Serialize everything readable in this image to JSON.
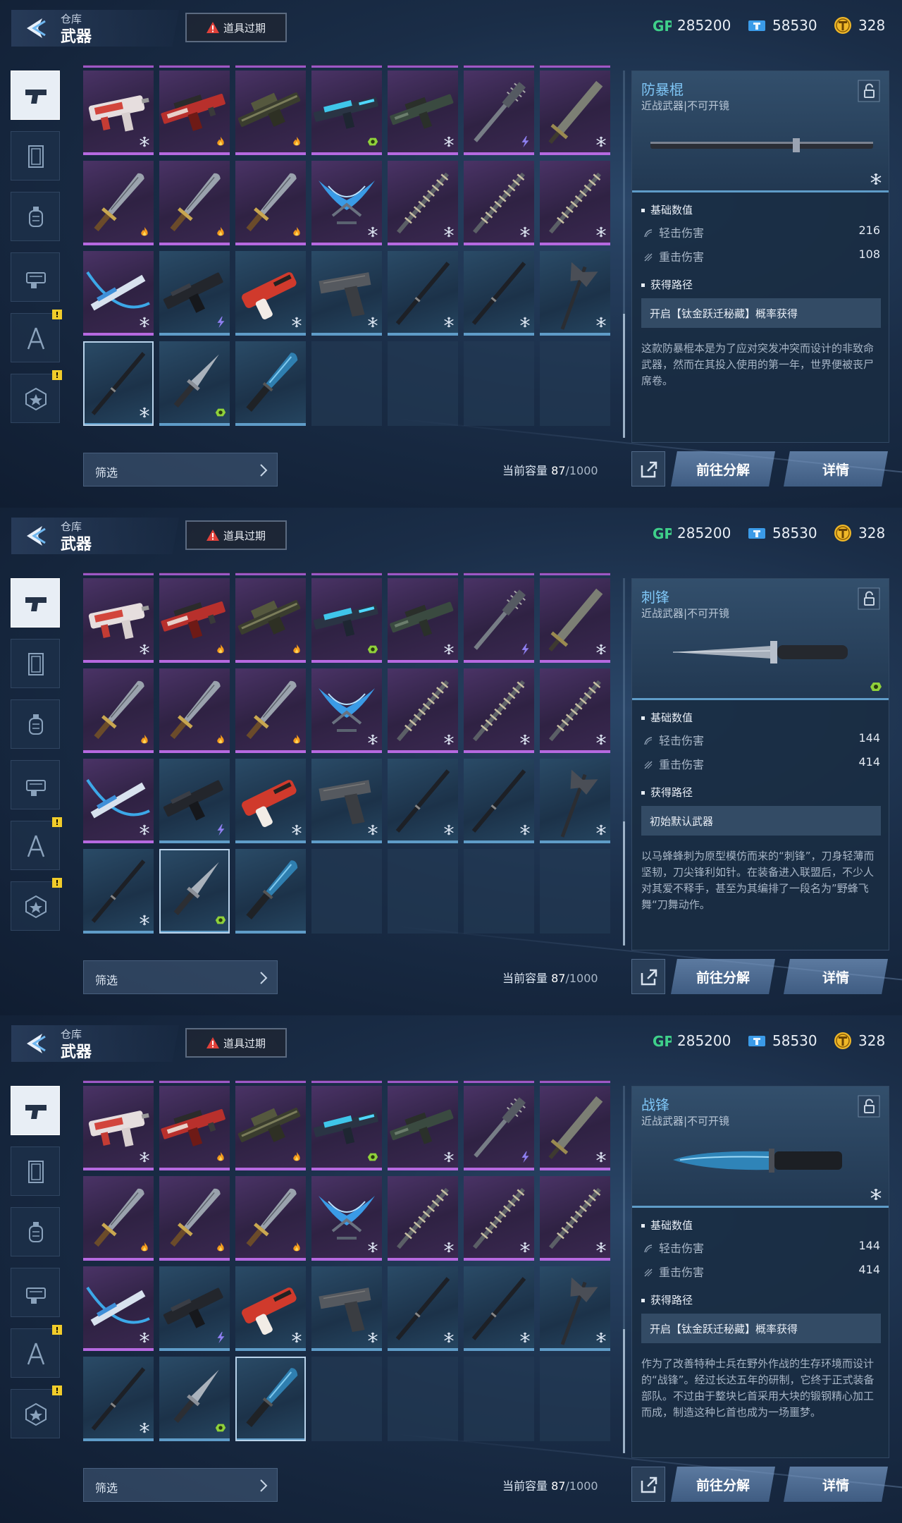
{
  "topbar": {
    "breadcrumb": "仓库",
    "title": "武器",
    "expired_label": "道具过期",
    "gp": {
      "label": "GP",
      "value": "285200"
    },
    "ticket": {
      "value": "58530"
    },
    "coin": {
      "value": "328"
    }
  },
  "sidebar": {
    "tabs": [
      {
        "icon": "pistol-icon"
      },
      {
        "icon": "card-icon"
      },
      {
        "icon": "grenade-icon"
      },
      {
        "icon": "gear-equipment-icon"
      },
      {
        "icon": "tools-icon",
        "badge": "!"
      },
      {
        "icon": "star-emblem-icon",
        "badge": "!"
      }
    ]
  },
  "inventory": {
    "filter_label": "筛选",
    "capacity_label": "当前容量",
    "capacity_current": "87",
    "capacity_total": "/1000"
  },
  "actions": {
    "decompose": "前往分解",
    "details": "详情"
  },
  "weapons_grid": [
    {
      "kind": "smg-white",
      "rarity": "purple",
      "quality": "snowflake"
    },
    {
      "kind": "rifle-red",
      "rarity": "purple",
      "quality": "flame"
    },
    {
      "kind": "lmg-camo",
      "rarity": "purple",
      "quality": "flame"
    },
    {
      "kind": "rifle-cyan",
      "rarity": "purple",
      "quality": "green"
    },
    {
      "kind": "rifle-dark",
      "rarity": "purple",
      "quality": "snowflake"
    },
    {
      "kind": "spiked-club",
      "rarity": "purple",
      "quality": "lightning"
    },
    {
      "kind": "greatsword",
      "rarity": "purple",
      "quality": "snowflake"
    },
    {
      "kind": "knife",
      "rarity": "purple",
      "quality": "flame"
    },
    {
      "kind": "knife",
      "rarity": "purple",
      "quality": "flame"
    },
    {
      "kind": "knife",
      "rarity": "purple",
      "quality": "flame"
    },
    {
      "kind": "dual-blades",
      "rarity": "purple",
      "quality": "snowflake"
    },
    {
      "kind": "chain-rod",
      "rarity": "purple",
      "quality": "snowflake"
    },
    {
      "kind": "chain-rod",
      "rarity": "purple",
      "quality": "snowflake"
    },
    {
      "kind": "chain-rod",
      "rarity": "purple",
      "quality": "snowflake"
    },
    {
      "kind": "crossbow",
      "rarity": "purple",
      "quality": "snowflake"
    },
    {
      "kind": "smg-black",
      "rarity": "blue",
      "quality": "lightning"
    },
    {
      "kind": "nailgun-red",
      "rarity": "blue",
      "quality": "snowflake"
    },
    {
      "kind": "pistol",
      "rarity": "blue",
      "quality": "snowflake"
    },
    {
      "kind": "baton",
      "rarity": "blue",
      "quality": "snowflake"
    },
    {
      "kind": "baton",
      "rarity": "blue",
      "quality": "snowflake"
    },
    {
      "kind": "axe",
      "rarity": "blue",
      "quality": "snowflake"
    },
    {
      "kind": "baton",
      "rarity": "blue",
      "quality": "snowflake"
    },
    {
      "kind": "stiletto",
      "rarity": "blue",
      "quality": "green"
    },
    {
      "kind": "combat-knife",
      "rarity": "blue",
      "quality": "none"
    }
  ],
  "panels": [
    {
      "selected_index": 21,
      "item": {
        "name": "防暴棍",
        "type": "近战武器|不可开镜",
        "art": "baton",
        "quality": "snowflake",
        "stats_header": "基础数值",
        "light_label": "轻击伤害",
        "light_value": "216",
        "heavy_label": "重击伤害",
        "heavy_value": "108",
        "source_header": "获得路径",
        "source": "开启【钛金跃迁秘藏】概率获得",
        "description": "这款防暴棍本是为了应对突发冲突而设计的非致命武器，然而在其投入使用的第一年，世界便被丧尸席卷。"
      }
    },
    {
      "selected_index": 22,
      "item": {
        "name": "刺锋",
        "type": "近战武器|不可开镜",
        "art": "stiletto",
        "quality": "green",
        "stats_header": "基础数值",
        "light_label": "轻击伤害",
        "light_value": "144",
        "heavy_label": "重击伤害",
        "heavy_value": "414",
        "source_header": "获得路径",
        "source": "初始默认武器",
        "description": "以马蜂蜂刺为原型模仿而来的“刺锋”，刀身轻薄而坚韧，刀尖锋利如针。在装备进入联盟后，不少人对其爱不释手，甚至为其编排了一段名为”野蜂飞舞“刀舞动作。"
      }
    },
    {
      "selected_index": 23,
      "item": {
        "name": "战锋",
        "type": "近战武器|不可开镜",
        "art": "combat-knife",
        "quality": "snowflake",
        "stats_header": "基础数值",
        "light_label": "轻击伤害",
        "light_value": "144",
        "heavy_label": "重击伤害",
        "heavy_value": "414",
        "source_header": "获得路径",
        "source": "开启【钛金跃迁秘藏】概率获得",
        "description": "作为了改善特种士兵在野外作战的生存环境而设计的“战锋”。经过长达五年的研制，它终于正式装备部队。不过由于整块匕首采用大块的锻钢精心加工而成，制造这种匕首也成为一场噩梦。"
      }
    }
  ],
  "colors": {
    "purple_rarity": "#b669e0",
    "blue_rarity": "#5f9cc8",
    "accent_name": "#7fc6f6",
    "badge_yellow": "#f1cc2a",
    "gp_green": "#3fd08a",
    "coin_gold": "#f0b828"
  }
}
